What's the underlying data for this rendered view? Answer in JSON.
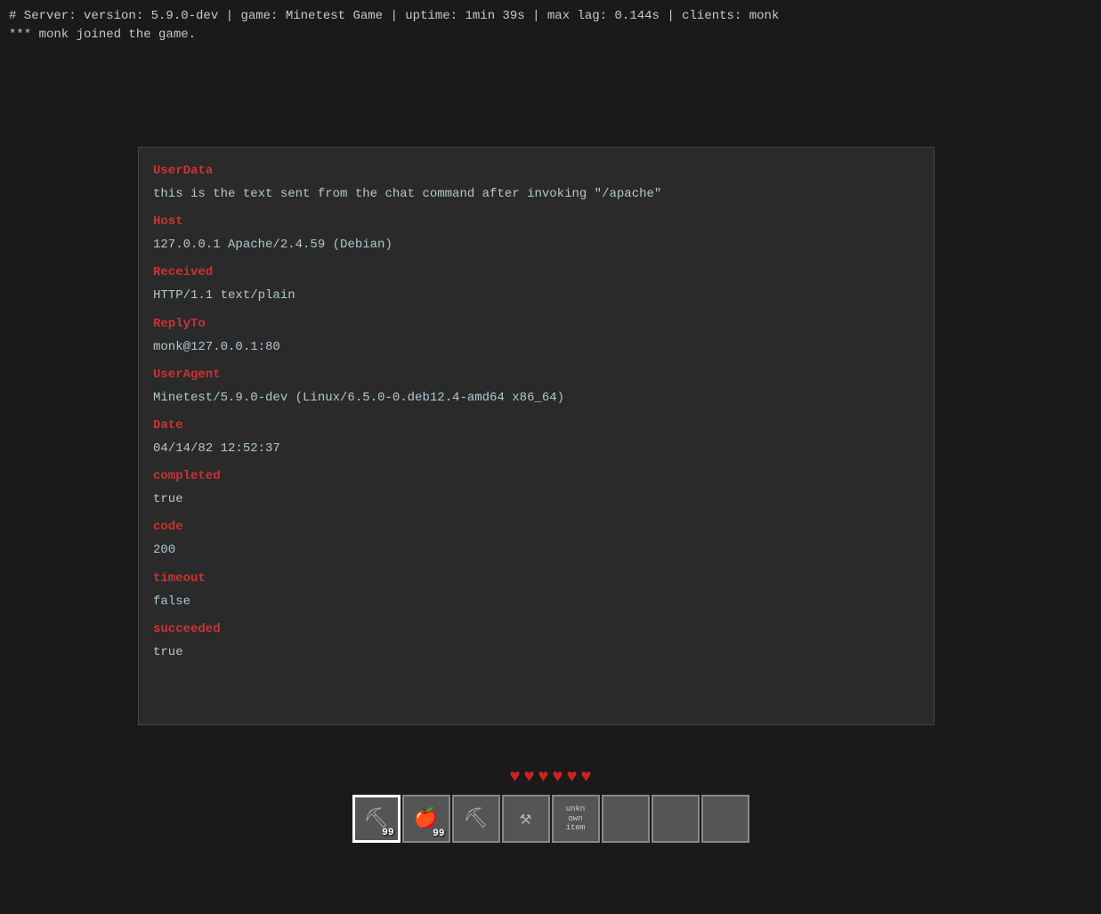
{
  "header": {
    "server_info": "# Server: version: 5.9.0-dev | game: Minetest Game | uptime: 1min 39s | max lag: 0.144s | clients: monk",
    "join_message": "*** monk joined the game."
  },
  "panel": {
    "fields": [
      {
        "label": "UserData",
        "value": "this is the text sent from the chat command after invoking \"/apache\""
      },
      {
        "label": "Host",
        "value": "127.0.0.1 Apache/2.4.59 (Debian)"
      },
      {
        "label": "Received",
        "value": "HTTP/1.1 text/plain"
      },
      {
        "label": "ReplyTo",
        "value": "monk@127.0.0.1:80"
      },
      {
        "label": "UserAgent",
        "value": "Minetest/5.9.0-dev (Linux/6.5.0-0.deb12.4-amd64 x86_64)"
      },
      {
        "label": "Date",
        "value": "04/14/82 12:52:37"
      },
      {
        "label": "completed",
        "value": "true"
      },
      {
        "label": "code",
        "value": "200"
      },
      {
        "label": "timeout",
        "value": "false"
      },
      {
        "label": "succeeded",
        "value": "true"
      }
    ]
  },
  "hud": {
    "hearts": [
      "♥",
      "♥",
      "♥",
      "♥",
      "♥",
      "♥"
    ],
    "hotbar_slots": [
      {
        "icon": "pickaxe",
        "count": "99",
        "active": true
      },
      {
        "icon": "apple",
        "count": "99",
        "active": false
      },
      {
        "icon": "pickaxe2",
        "count": "",
        "active": false
      },
      {
        "icon": "shovel",
        "count": "",
        "active": false
      },
      {
        "icon": "unknown",
        "label": "unkn\nown\nitem",
        "count": "",
        "active": false
      },
      {
        "icon": "empty",
        "count": "",
        "active": false
      },
      {
        "icon": "empty2",
        "count": "",
        "active": false
      },
      {
        "icon": "empty3",
        "count": "",
        "active": false
      }
    ]
  }
}
